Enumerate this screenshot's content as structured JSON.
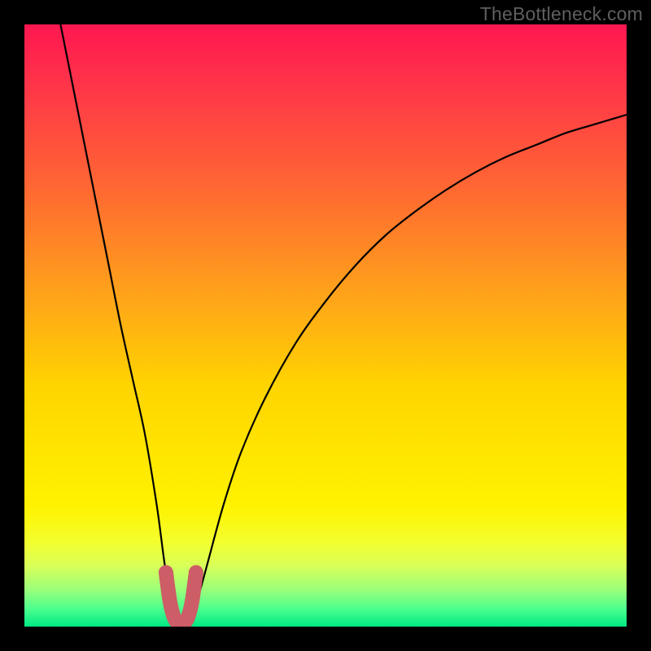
{
  "watermark": "TheBottleneck.com",
  "palette": {
    "frame": "#000000",
    "curve": "#000000",
    "highlight": "#cd5d66",
    "gradient_stops": [
      {
        "offset": 0.0,
        "color": "#ff1750"
      },
      {
        "offset": 0.12,
        "color": "#ff3a47"
      },
      {
        "offset": 0.28,
        "color": "#ff6a31"
      },
      {
        "offset": 0.45,
        "color": "#ffa31a"
      },
      {
        "offset": 0.6,
        "color": "#ffd400"
      },
      {
        "offset": 0.72,
        "color": "#ffe700"
      },
      {
        "offset": 0.8,
        "color": "#fff200"
      },
      {
        "offset": 0.86,
        "color": "#f3ff2e"
      },
      {
        "offset": 0.9,
        "color": "#d8ff5a"
      },
      {
        "offset": 0.94,
        "color": "#98ff7a"
      },
      {
        "offset": 0.97,
        "color": "#4dff8e"
      },
      {
        "offset": 1.0,
        "color": "#00e884"
      }
    ]
  },
  "chart_data": {
    "type": "line",
    "title": "",
    "xlabel": "",
    "ylabel": "",
    "xlim": [
      0,
      100
    ],
    "ylim": [
      0,
      100
    ],
    "series": [
      {
        "name": "bottleneck-curve",
        "x": [
          6,
          8,
          10,
          12,
          14,
          16,
          18,
          20,
          22,
          23.5,
          25,
          26,
          27,
          28,
          30,
          33,
          36,
          40,
          45,
          50,
          55,
          60,
          65,
          70,
          75,
          80,
          85,
          90,
          95,
          100
        ],
        "y": [
          100,
          90,
          80,
          70,
          60,
          50,
          41,
          32,
          20,
          9,
          2,
          0.5,
          0.5,
          2,
          9,
          20,
          29,
          38,
          47,
          54,
          60,
          65,
          69,
          72.5,
          75.5,
          78,
          80,
          82,
          83.5,
          85
        ]
      }
    ],
    "highlight": {
      "name": "sweet-spot-marker",
      "x": [
        23.5,
        24.2,
        25.0,
        26.0,
        27.0,
        27.8,
        28.5
      ],
      "y": [
        9,
        4,
        1.2,
        0.5,
        1.2,
        4,
        9
      ]
    }
  }
}
